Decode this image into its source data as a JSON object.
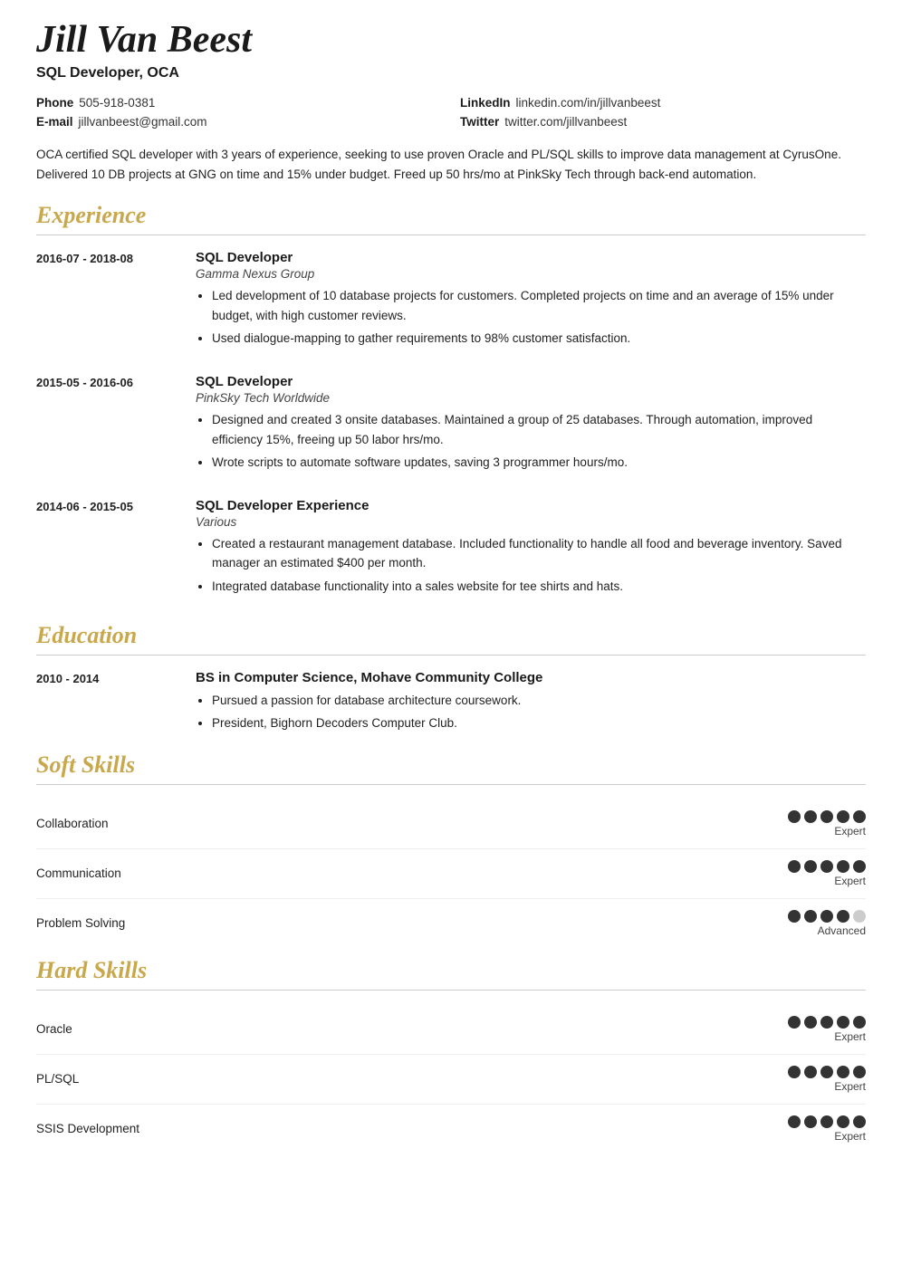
{
  "header": {
    "name": "Jill Van Beest",
    "title": "SQL Developer, OCA",
    "contacts": [
      {
        "label": "Phone",
        "value": "505-918-0381"
      },
      {
        "label": "LinkedIn",
        "value": "linkedin.com/in/jillvanbeest"
      },
      {
        "label": "E-mail",
        "value": "jillvanbeest@gmail.com"
      },
      {
        "label": "Twitter",
        "value": "twitter.com/jillvanbeest"
      }
    ],
    "summary": "OCA certified SQL developer with 3 years of experience, seeking to use proven Oracle and PL/SQL skills to improve data management at CyrusOne. Delivered 10 DB projects at GNG on time and 15% under budget. Freed up 50 hrs/mo at PinkSky Tech through back-end automation."
  },
  "sections": {
    "experience_label": "Experience",
    "education_label": "Education",
    "soft_skills_label": "Soft Skills",
    "hard_skills_label": "Hard Skills"
  },
  "experience": [
    {
      "date": "2016-07 - 2018-08",
      "role": "SQL Developer",
      "company": "Gamma Nexus Group",
      "bullets": [
        "Led development of 10 database projects for customers. Completed projects on time and an average of 15% under budget, with high customer reviews.",
        "Used dialogue-mapping to gather requirements to 98% customer satisfaction."
      ]
    },
    {
      "date": "2015-05 - 2016-06",
      "role": "SQL Developer",
      "company": "PinkSky Tech Worldwide",
      "bullets": [
        "Designed and created 3 onsite databases. Maintained a group of 25 databases. Through automation, improved efficiency 15%, freeing up 50 labor hrs/mo.",
        "Wrote scripts to automate software updates, saving 3 programmer hours/mo."
      ]
    },
    {
      "date": "2014-06 - 2015-05",
      "role": "SQL Developer Experience",
      "company": "Various",
      "bullets": [
        "Created a restaurant management database. Included functionality to handle all food and beverage inventory. Saved manager an estimated $400 per month.",
        "Integrated database functionality into a sales website for tee shirts and hats."
      ]
    }
  ],
  "education": [
    {
      "date": "2010 - 2014",
      "degree": "BS in Computer Science, Mohave Community College",
      "bullets": [
        "Pursued a passion for database architecture coursework.",
        "President, Bighorn Decoders Computer Club."
      ]
    }
  ],
  "soft_skills": [
    {
      "name": "Collaboration",
      "filled": 5,
      "total": 5,
      "level": "Expert"
    },
    {
      "name": "Communication",
      "filled": 5,
      "total": 5,
      "level": "Expert"
    },
    {
      "name": "Problem Solving",
      "filled": 4,
      "total": 5,
      "level": "Advanced"
    }
  ],
  "hard_skills": [
    {
      "name": "Oracle",
      "filled": 5,
      "total": 5,
      "level": "Expert"
    },
    {
      "name": "PL/SQL",
      "filled": 5,
      "total": 5,
      "level": "Expert"
    },
    {
      "name": "SSIS Development",
      "filled": 5,
      "total": 5,
      "level": "Expert"
    }
  ]
}
